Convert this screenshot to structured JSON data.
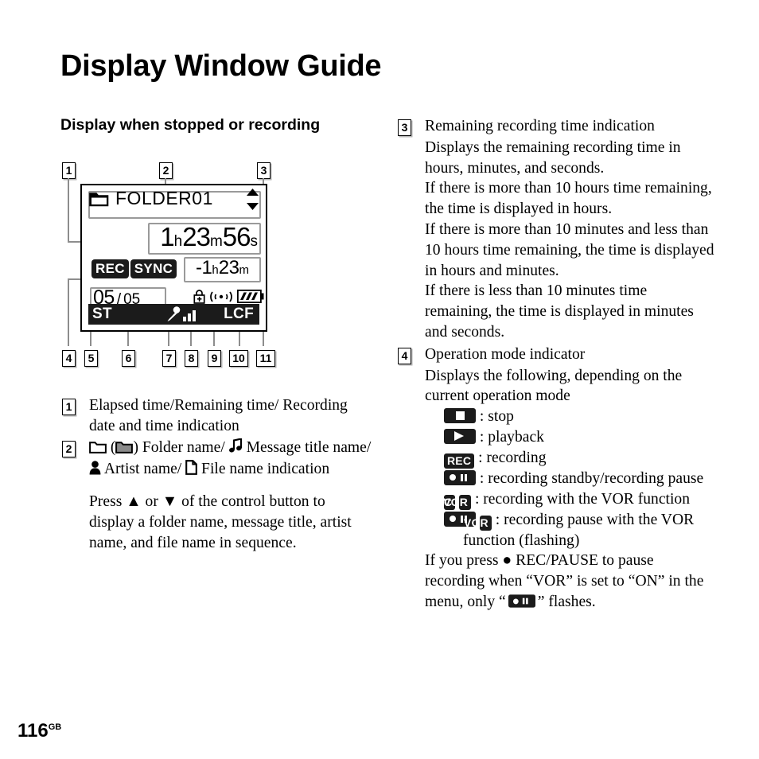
{
  "page": {
    "title": "Display Window Guide",
    "number": "116",
    "number_suffix": "GB"
  },
  "section": {
    "heading": "Display when stopped or recording"
  },
  "figure": {
    "callouts": [
      "1",
      "2",
      "3",
      "4",
      "5",
      "6",
      "7",
      "8",
      "9",
      "10",
      "11"
    ],
    "lcd": {
      "folder_name": "FOLDER01",
      "folder_icon": "folder-icon",
      "updown_icon": "up-down-arrows-icon",
      "elapsed_time": {
        "hours": "1",
        "h_unit": "h",
        "minutes": "23",
        "m_unit": "m",
        "seconds": "56",
        "s_unit": "s"
      },
      "badge_rec": "REC",
      "badge_sync": "SYNC",
      "remaining_time": {
        "value": "-1",
        "h_unit": "h",
        "minutes": "23",
        "m_unit": "m"
      },
      "file_counter": {
        "current": "05",
        "separator": "/",
        "total": "05"
      },
      "small_icons": [
        "lock-icon",
        "remote-signal-icon",
        "battery-icon"
      ],
      "status_bar": {
        "left_label": "ST",
        "mic_icon": "microphone-level-icon",
        "right_label": "LCF"
      }
    }
  },
  "left_column": {
    "item1": {
      "num": "1",
      "text": "Elapsed time/Remaining time/ Recording date and time indication"
    },
    "item2": {
      "num": "2",
      "line1_a": "(",
      "line1_b": ") Folder name/",
      "line1_c": "Message title name/",
      "line1_d": "Artist name/",
      "line1_e": "File name indication",
      "icons": [
        "folder-outline-icon",
        "folder-filled-icon",
        "music-note-icon",
        "person-icon",
        "file-icon"
      ],
      "para": "Press ▲ or ▼ of the control button to display a folder name, message title, artist name, and file name in sequence."
    }
  },
  "right_column": {
    "item3": {
      "num": "3",
      "title": "Remaining recording time indication",
      "paras": [
        "Displays the remaining recording time in hours, minutes, and seconds.",
        "If there is more than 10 hours time remaining, the time is displayed in hours.",
        "If there is more than 10 minutes and less than 10 hours time remaining, the time is displayed in hours and minutes.",
        "If there is less than 10 minutes time remaining, the time is displayed in minutes and seconds."
      ]
    },
    "item4": {
      "num": "4",
      "title": "Operation mode indicator",
      "intro": "Displays the following, depending on the current operation mode",
      "modes": [
        {
          "icon": "stop-icon",
          "label": ": stop"
        },
        {
          "icon": "playback-icon",
          "label": ": playback"
        },
        {
          "icon": "rec-badge",
          "badge_text": "REC",
          "label": ": recording"
        },
        {
          "icon": "rec-pause-icon",
          "label": ": recording standby/recording pause"
        },
        {
          "icon": "rec-vor-icon",
          "badge_text": "REC",
          "badge_text2": "VOR",
          "label": ": recording with the VOR function"
        },
        {
          "icon": "pause-vor-icon",
          "badge_text2": "VOR",
          "label": ": recording pause with the VOR function (flashing)"
        }
      ],
      "note_a": "If you press ● REC/PAUSE to pause recording when “VOR” is set to “ON” in the menu, only “",
      "note_b": "” flashes."
    }
  },
  "colors": {
    "ink": "#000000",
    "lcd_badge": "#1b1b1b",
    "zone_outline": "#9a9a9a",
    "leader": "#8d8d8d",
    "folder_fill": "#8a8a8a"
  }
}
